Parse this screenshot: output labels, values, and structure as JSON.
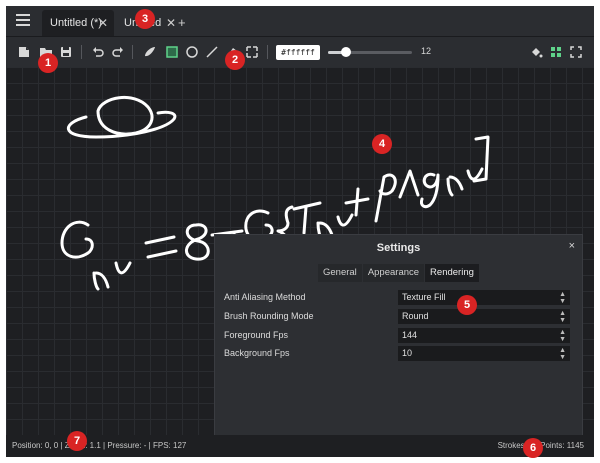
{
  "tabs": [
    {
      "label": "Untitled (*)",
      "active": true
    },
    {
      "label": "Untitled",
      "active": false
    }
  ],
  "add_tab": "+",
  "toolbar": {
    "color_value": "#ffffff",
    "brush_size": "12",
    "brush_size_fraction": 0.22
  },
  "settings": {
    "title": "Settings",
    "close": "×",
    "tabs": [
      "General",
      "Appearance",
      "Rendering"
    ],
    "active_tab": "Rendering",
    "fields": [
      {
        "label": "Anti Aliasing Method",
        "value": "Texture Fill"
      },
      {
        "label": "Brush Rounding Mode",
        "value": "Round"
      },
      {
        "label": "Foreground Fps",
        "value": "144"
      },
      {
        "label": "Background Fps",
        "value": "10"
      }
    ]
  },
  "status": {
    "position": "Position: 0, 0",
    "zoom": "Zoom: 1.1",
    "pressure": "Pressure: -",
    "fps": "FPS: 127",
    "strokes": "Strokes: 8",
    "points": "Points: 1145"
  },
  "badges": [
    "1",
    "2",
    "3",
    "4",
    "5",
    "6",
    "7"
  ],
  "colors": {
    "badge": "#d92424",
    "background": "#1e1f22",
    "toolbar": "#2b2d31"
  }
}
